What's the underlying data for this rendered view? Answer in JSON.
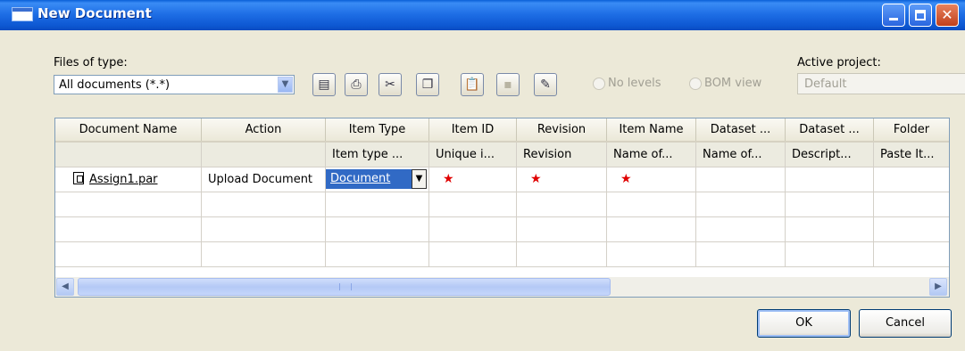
{
  "window": {
    "title": "New Document"
  },
  "files_of_type": {
    "label": "Files of type:",
    "value": "All documents (*.*)"
  },
  "toolbar": {
    "icons": [
      "properties-icon",
      "print-icon",
      "cut-icon",
      "copy-icon",
      "paste-icon",
      "disabled-tool-icon",
      "edit-icon"
    ]
  },
  "view_options": {
    "no_levels": "No levels",
    "bom_view": "BOM view"
  },
  "active_project": {
    "label": "Active project:",
    "value": "Default"
  },
  "grid": {
    "columns": [
      "Document Name",
      "Action",
      "Item Type",
      "Item ID",
      "Revision",
      "Item Name",
      "Dataset ...",
      "Dataset ...",
      "Folder"
    ],
    "sub_headers": [
      "",
      "",
      "Item type ...",
      "Unique i...",
      "Revision",
      "Name of...",
      "Name of...",
      "Descript...",
      "Paste It..."
    ],
    "rows": [
      {
        "document_name": "Assign1.par",
        "action": "Upload Document",
        "item_type": "Document",
        "item_id": "★",
        "revision": "★",
        "item_name": "★"
      }
    ]
  },
  "buttons": {
    "ok": "OK",
    "cancel": "Cancel"
  },
  "colors": {
    "title_bar": "#0a5fd6",
    "selection": "#316ac5",
    "required_marker": "#e00000"
  }
}
